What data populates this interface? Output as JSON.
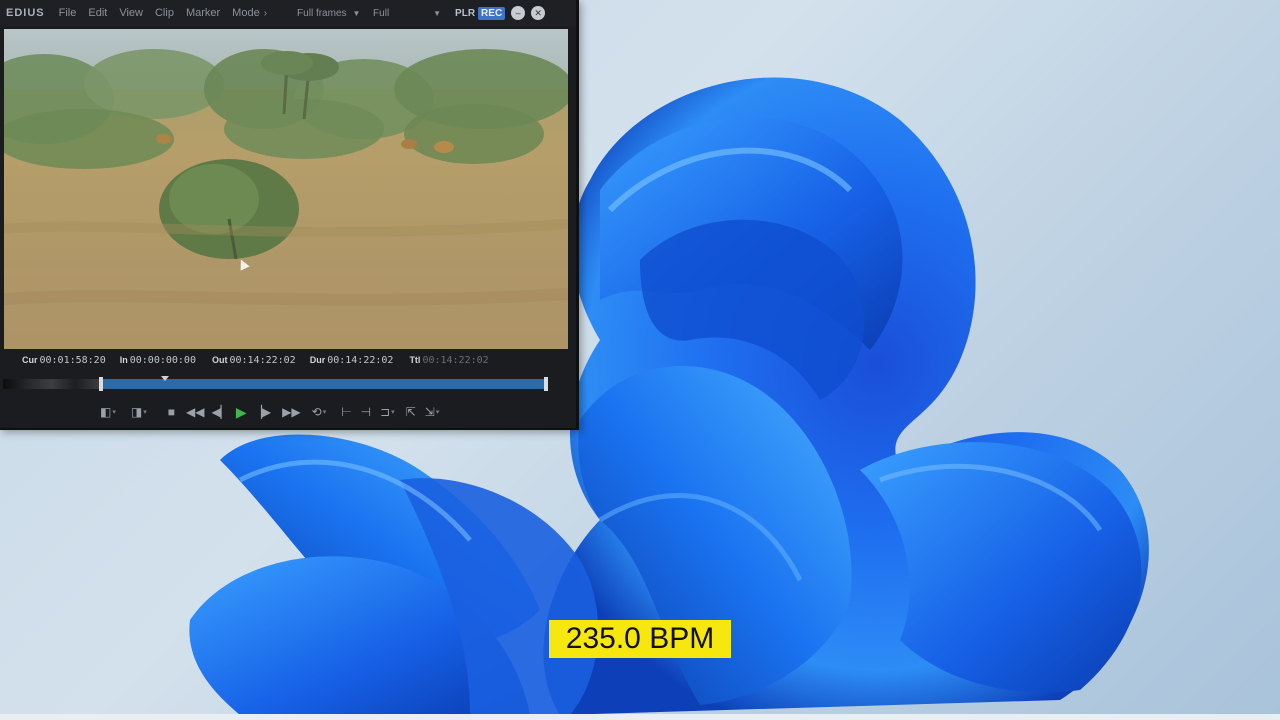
{
  "app": {
    "logo": "EDIUS",
    "menu": [
      "File",
      "Edit",
      "View",
      "Clip",
      "Marker",
      "Mode"
    ],
    "menu_more": "›",
    "frames_dropdown": "Full frames",
    "quality_dropdown": "Full",
    "mode_plr": "PLR",
    "mode_rec": "REC"
  },
  "timecodes": {
    "cur": {
      "label": "Cur",
      "value": "00:01:58:20"
    },
    "in": {
      "label": "In",
      "value": "00:00:00:00"
    },
    "out": {
      "label": "Out",
      "value": "00:14:22:02"
    },
    "dur": {
      "label": "Dur",
      "value": "00:14:22:02"
    },
    "ttl": {
      "label": "Ttl",
      "value": "00:14:22:02"
    }
  },
  "toolbar": {
    "buttons": [
      "set-in",
      "set-out",
      "stop",
      "rewind",
      "step-back",
      "play",
      "step-forward",
      "fast-forward",
      "loop",
      "insert",
      "overwrite",
      "match-frame",
      "export",
      "export-options"
    ]
  },
  "overlay": {
    "bpm_text": "235.0 BPM"
  },
  "colors": {
    "rec_accent": "#3e74c7",
    "scrub_track": "#2d6aa8",
    "play_green": "#3fb54a",
    "bpm_background": "#f6e80f"
  }
}
